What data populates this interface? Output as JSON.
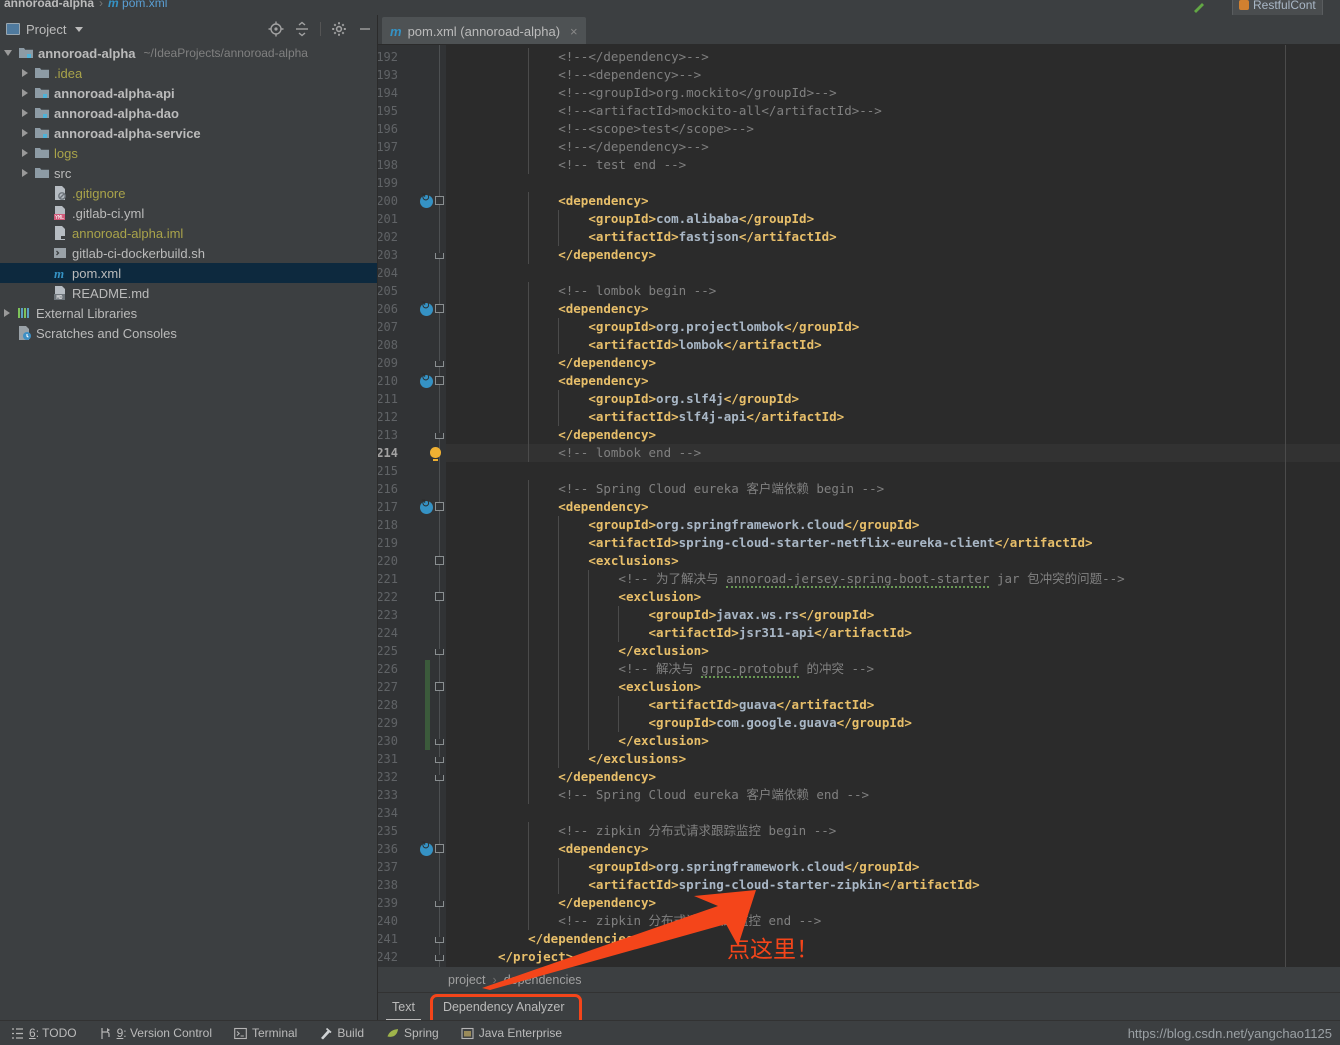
{
  "window": {
    "breadcrumb_project": "annoroad-alpha",
    "breadcrumb_sep": "›",
    "breadcrumb_file": "pom.xml",
    "maven_mark": "m",
    "restful_button": "RestfulCont",
    "hammer_icon": "build-hammer-icon"
  },
  "tool_window": {
    "title": "Project",
    "actions": [
      {
        "name": "locate-icon",
        "label": "Select Opened File"
      },
      {
        "name": "collapse-all-icon",
        "label": "Collapse All"
      },
      {
        "name": "gear-icon",
        "label": "Settings"
      },
      {
        "name": "minimize-icon",
        "label": "Hide"
      }
    ],
    "tree": [
      {
        "depth": 0,
        "arrow": "open",
        "icon": "module-folder-icon",
        "label": "annoroad-alpha",
        "style": "bold",
        "path": "~/IdeaProjects/annoroad-alpha"
      },
      {
        "depth": 1,
        "arrow": "closed",
        "icon": "folder-icon",
        "label": ".idea",
        "style": "olive",
        "path": ""
      },
      {
        "depth": 1,
        "arrow": "closed",
        "icon": "module-folder-icon",
        "label": "annoroad-alpha-api",
        "style": "bold",
        "path": ""
      },
      {
        "depth": 1,
        "arrow": "closed",
        "icon": "module-folder-icon",
        "label": "annoroad-alpha-dao",
        "style": "bold",
        "path": ""
      },
      {
        "depth": 1,
        "arrow": "closed",
        "icon": "module-folder-icon",
        "label": "annoroad-alpha-service",
        "style": "bold",
        "path": ""
      },
      {
        "depth": 1,
        "arrow": "closed",
        "icon": "folder-icon",
        "label": "logs",
        "style": "olive",
        "path": ""
      },
      {
        "depth": 1,
        "arrow": "closed",
        "icon": "folder-icon",
        "label": "src",
        "style": "",
        "path": ""
      },
      {
        "depth": 2,
        "arrow": "none",
        "icon": "gitignore-file-icon",
        "label": ".gitignore",
        "style": "olive",
        "path": ""
      },
      {
        "depth": 2,
        "arrow": "none",
        "icon": "yml-file-icon",
        "label": ".gitlab-ci.yml",
        "style": "",
        "path": ""
      },
      {
        "depth": 2,
        "arrow": "none",
        "icon": "iml-file-icon",
        "label": "annoroad-alpha.iml",
        "style": "olive",
        "path": ""
      },
      {
        "depth": 2,
        "arrow": "none",
        "icon": "shell-file-icon",
        "label": "gitlab-ci-dockerbuild.sh",
        "style": "",
        "path": ""
      },
      {
        "depth": 2,
        "arrow": "none",
        "icon": "maven-file-icon",
        "label": "pom.xml",
        "style": "",
        "path": "",
        "selected": true
      },
      {
        "depth": 2,
        "arrow": "none",
        "icon": "md-file-icon",
        "label": "README.md",
        "style": "",
        "path": ""
      },
      {
        "depth": 0,
        "arrow": "closed",
        "icon": "libraries-icon",
        "label": "External Libraries",
        "style": "",
        "path": ""
      },
      {
        "depth": 0,
        "arrow": "none",
        "icon": "scratches-icon",
        "label": "Scratches and Consoles",
        "style": "",
        "path": ""
      }
    ]
  },
  "editor": {
    "tab_label": "pom.xml (annoroad-alpha)",
    "tab_icon": "maven-file-icon",
    "tab_close": "×",
    "first_line": 192,
    "active_line": 214,
    "lines": [
      {
        "n": 192,
        "indent": 8,
        "spans": [
          [
            "cm",
            "<!--</dependency>-->"
          ]
        ]
      },
      {
        "n": 193,
        "indent": 8,
        "spans": [
          [
            "cm",
            "<!--<dependency>-->"
          ]
        ]
      },
      {
        "n": 194,
        "indent": 8,
        "spans": [
          [
            "cm",
            "<!--<groupId>org.mockito</groupId>-->"
          ]
        ]
      },
      {
        "n": 195,
        "indent": 8,
        "spans": [
          [
            "cm",
            "<!--<artifactId>mockito-all</artifactId>-->"
          ]
        ]
      },
      {
        "n": 196,
        "indent": 8,
        "spans": [
          [
            "cm",
            "<!--<scope>test</scope>-->"
          ]
        ]
      },
      {
        "n": 197,
        "indent": 8,
        "spans": [
          [
            "cm",
            "<!--</dependency>-->"
          ]
        ]
      },
      {
        "n": 198,
        "indent": 8,
        "spans": [
          [
            "cm",
            "<!-- test end -->"
          ]
        ]
      },
      {
        "n": 199,
        "indent": 0,
        "spans": []
      },
      {
        "n": 200,
        "indent": 8,
        "spans": [
          [
            "tg",
            "<dependency>"
          ]
        ],
        "mvn": true,
        "fold": "start"
      },
      {
        "n": 201,
        "indent": 12,
        "spans": [
          [
            "tg",
            "<groupId>"
          ],
          [
            "txt",
            "com.alibaba"
          ],
          [
            "tg",
            "</groupId>"
          ]
        ]
      },
      {
        "n": 202,
        "indent": 12,
        "spans": [
          [
            "tg",
            "<artifactId>"
          ],
          [
            "txt",
            "fastjson"
          ],
          [
            "tg",
            "</artifactId>"
          ]
        ]
      },
      {
        "n": 203,
        "indent": 8,
        "spans": [
          [
            "tg",
            "</dependency>"
          ]
        ],
        "fold": "end"
      },
      {
        "n": 204,
        "indent": 0,
        "spans": []
      },
      {
        "n": 205,
        "indent": 8,
        "spans": [
          [
            "cm",
            "<!-- lombok begin -->"
          ]
        ]
      },
      {
        "n": 206,
        "indent": 8,
        "spans": [
          [
            "tg",
            "<dependency>"
          ]
        ],
        "mvn": true,
        "fold": "start"
      },
      {
        "n": 207,
        "indent": 12,
        "spans": [
          [
            "tg",
            "<groupId>"
          ],
          [
            "txt",
            "org.projectlombok"
          ],
          [
            "tg",
            "</groupId>"
          ]
        ]
      },
      {
        "n": 208,
        "indent": 12,
        "spans": [
          [
            "tg",
            "<artifactId>"
          ],
          [
            "txt",
            "lombok"
          ],
          [
            "tg",
            "</artifactId>"
          ]
        ]
      },
      {
        "n": 209,
        "indent": 8,
        "spans": [
          [
            "tg",
            "</dependency>"
          ]
        ],
        "fold": "end"
      },
      {
        "n": 210,
        "indent": 8,
        "spans": [
          [
            "tg",
            "<dependency>"
          ]
        ],
        "mvn": true,
        "fold": "start"
      },
      {
        "n": 211,
        "indent": 12,
        "spans": [
          [
            "tg",
            "<groupId>"
          ],
          [
            "txt",
            "org.slf4j"
          ],
          [
            "tg",
            "</groupId>"
          ]
        ]
      },
      {
        "n": 212,
        "indent": 12,
        "spans": [
          [
            "tg",
            "<artifactId>"
          ],
          [
            "txt",
            "slf4j-api"
          ],
          [
            "tg",
            "</artifactId>"
          ]
        ]
      },
      {
        "n": 213,
        "indent": 8,
        "spans": [
          [
            "tg",
            "</dependency>"
          ]
        ],
        "fold": "end"
      },
      {
        "n": 214,
        "indent": 8,
        "spans": [
          [
            "cm",
            "<!-- lombok end -->"
          ]
        ],
        "bulb": true,
        "active": true
      },
      {
        "n": 215,
        "indent": 0,
        "spans": []
      },
      {
        "n": 216,
        "indent": 8,
        "spans": [
          [
            "cm",
            "<!-- Spring Cloud eureka 客户端依赖 begin -->"
          ]
        ]
      },
      {
        "n": 217,
        "indent": 8,
        "spans": [
          [
            "tg",
            "<dependency>"
          ]
        ],
        "mvn": true,
        "fold": "start"
      },
      {
        "n": 218,
        "indent": 12,
        "spans": [
          [
            "tg",
            "<groupId>"
          ],
          [
            "txt",
            "org.springframework.cloud"
          ],
          [
            "tg",
            "</groupId>"
          ]
        ]
      },
      {
        "n": 219,
        "indent": 12,
        "spans": [
          [
            "tg",
            "<artifactId>"
          ],
          [
            "txt",
            "spring-cloud-starter-netflix-eureka-client"
          ],
          [
            "tg",
            "</artifactId>"
          ]
        ]
      },
      {
        "n": 220,
        "indent": 12,
        "spans": [
          [
            "tg",
            "<exclusions>"
          ]
        ],
        "fold": "start"
      },
      {
        "n": 221,
        "indent": 16,
        "spans": [
          [
            "cm",
            "<!-- 为了解决与 "
          ],
          [
            "sq",
            "annoroad-jersey-spring-boot-starter"
          ],
          [
            "cm",
            " jar 包冲突的问题-->"
          ]
        ]
      },
      {
        "n": 222,
        "indent": 16,
        "spans": [
          [
            "tg",
            "<exclusion>"
          ]
        ],
        "fold": "start"
      },
      {
        "n": 223,
        "indent": 20,
        "spans": [
          [
            "tg",
            "<groupId>"
          ],
          [
            "txt",
            "javax.ws.rs"
          ],
          [
            "tg",
            "</groupId>"
          ]
        ]
      },
      {
        "n": 224,
        "indent": 20,
        "spans": [
          [
            "tg",
            "<artifactId>"
          ],
          [
            "txt",
            "jsr311-api"
          ],
          [
            "tg",
            "</artifactId>"
          ]
        ]
      },
      {
        "n": 225,
        "indent": 16,
        "spans": [
          [
            "tg",
            "</exclusion>"
          ]
        ],
        "fold": "end"
      },
      {
        "n": 226,
        "indent": 16,
        "spans": [
          [
            "cm",
            "<!-- 解决与 "
          ],
          [
            "sq",
            "grpc-protobuf"
          ],
          [
            "cm",
            " 的冲突 -->"
          ]
        ],
        "chg": true
      },
      {
        "n": 227,
        "indent": 16,
        "spans": [
          [
            "tg",
            "<exclusion>"
          ]
        ],
        "fold": "start",
        "chg": true
      },
      {
        "n": 228,
        "indent": 20,
        "spans": [
          [
            "tg",
            "<artifactId>"
          ],
          [
            "txt",
            "guava"
          ],
          [
            "tg",
            "</artifactId>"
          ]
        ],
        "chg": true
      },
      {
        "n": 229,
        "indent": 20,
        "spans": [
          [
            "tg",
            "<groupId>"
          ],
          [
            "txt",
            "com.google.guava"
          ],
          [
            "tg",
            "</groupId>"
          ]
        ],
        "chg": true
      },
      {
        "n": 230,
        "indent": 16,
        "spans": [
          [
            "tg",
            "</exclusion>"
          ]
        ],
        "fold": "end",
        "chg": true
      },
      {
        "n": 231,
        "indent": 12,
        "spans": [
          [
            "tg",
            "</exclusions>"
          ]
        ],
        "fold": "end"
      },
      {
        "n": 232,
        "indent": 8,
        "spans": [
          [
            "tg",
            "</dependency>"
          ]
        ],
        "fold": "end"
      },
      {
        "n": 233,
        "indent": 8,
        "spans": [
          [
            "cm",
            "<!-- Spring Cloud eureka 客户端依赖 end -->"
          ]
        ]
      },
      {
        "n": 234,
        "indent": 0,
        "spans": []
      },
      {
        "n": 235,
        "indent": 8,
        "spans": [
          [
            "cm",
            "<!-- zipkin 分布式请求跟踪监控 begin -->"
          ]
        ]
      },
      {
        "n": 236,
        "indent": 8,
        "spans": [
          [
            "tg",
            "<dependency>"
          ]
        ],
        "mvn": true,
        "fold": "start"
      },
      {
        "n": 237,
        "indent": 12,
        "spans": [
          [
            "tg",
            "<groupId>"
          ],
          [
            "txt",
            "org.springframework.cloud"
          ],
          [
            "tg",
            "</groupId>"
          ]
        ]
      },
      {
        "n": 238,
        "indent": 12,
        "spans": [
          [
            "tg",
            "<artifactId>"
          ],
          [
            "txt",
            "spring-cloud-starter-zipkin"
          ],
          [
            "tg",
            "</artifactId>"
          ]
        ]
      },
      {
        "n": 239,
        "indent": 8,
        "spans": [
          [
            "tg",
            "</dependency>"
          ]
        ],
        "fold": "end"
      },
      {
        "n": 240,
        "indent": 8,
        "spans": [
          [
            "cm",
            "<!-- zipkin 分布式请求跟踪监控 end -->"
          ]
        ]
      },
      {
        "n": 241,
        "indent": 4,
        "spans": [
          [
            "tg",
            "</dependencies>"
          ]
        ],
        "fold": "end"
      },
      {
        "n": 242,
        "indent": 0,
        "spans": [
          [
            "tg",
            "</project>"
          ]
        ],
        "fold": "end"
      }
    ],
    "breadcrumb": [
      "project",
      "dependencies"
    ],
    "breadcrumb_sep": "›",
    "bottom_tabs": [
      {
        "label": "Text",
        "active": true
      },
      {
        "label": "Dependency Analyzer",
        "active": false,
        "highlighted": true
      }
    ]
  },
  "annotation": {
    "text": "点这里！",
    "color": "#f4451a",
    "arrow": "arrow-pointing-up-right"
  },
  "status_bar": {
    "items": [
      {
        "icon": "todo-list-icon",
        "prefix": "6",
        "label": ": TODO"
      },
      {
        "icon": "version-control-icon",
        "prefix": "9",
        "label": ": Version Control"
      },
      {
        "icon": "terminal-icon",
        "prefix": "",
        "label": "Terminal"
      },
      {
        "icon": "build-hammer-icon",
        "prefix": "",
        "label": "Build"
      },
      {
        "icon": "spring-leaf-icon",
        "prefix": "",
        "label": "Spring"
      },
      {
        "icon": "java-enterprise-icon",
        "prefix": "",
        "label": "Java Enterprise"
      }
    ],
    "watermark": "https://blog.csdn.net/yangchao1125"
  }
}
